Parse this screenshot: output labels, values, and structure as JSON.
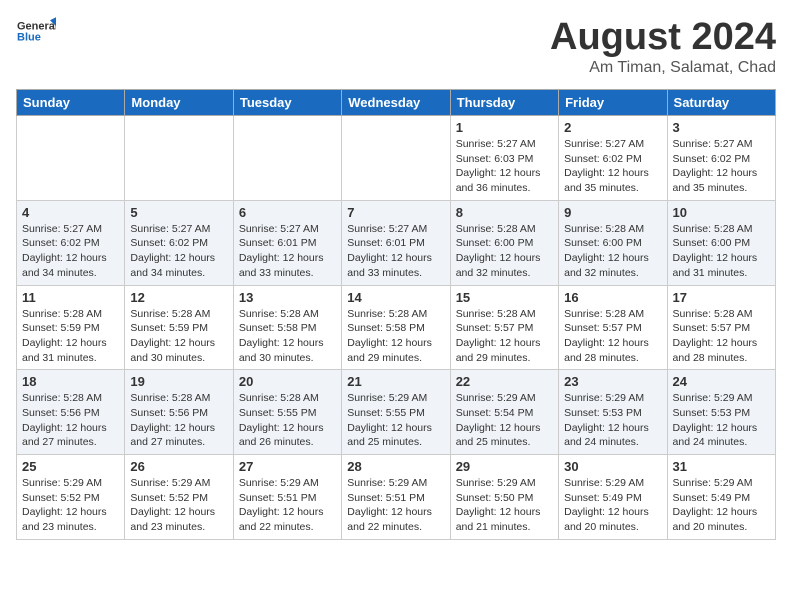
{
  "header": {
    "logo_general": "General",
    "logo_blue": "Blue",
    "month_title": "August 2024",
    "location": "Am Timan, Salamat, Chad"
  },
  "days_of_week": [
    "Sunday",
    "Monday",
    "Tuesday",
    "Wednesday",
    "Thursday",
    "Friday",
    "Saturday"
  ],
  "weeks": [
    {
      "alt": false,
      "days": [
        {
          "num": "",
          "info": ""
        },
        {
          "num": "",
          "info": ""
        },
        {
          "num": "",
          "info": ""
        },
        {
          "num": "",
          "info": ""
        },
        {
          "num": "1",
          "info": "Sunrise: 5:27 AM\nSunset: 6:03 PM\nDaylight: 12 hours\nand 36 minutes."
        },
        {
          "num": "2",
          "info": "Sunrise: 5:27 AM\nSunset: 6:02 PM\nDaylight: 12 hours\nand 35 minutes."
        },
        {
          "num": "3",
          "info": "Sunrise: 5:27 AM\nSunset: 6:02 PM\nDaylight: 12 hours\nand 35 minutes."
        }
      ]
    },
    {
      "alt": true,
      "days": [
        {
          "num": "4",
          "info": "Sunrise: 5:27 AM\nSunset: 6:02 PM\nDaylight: 12 hours\nand 34 minutes."
        },
        {
          "num": "5",
          "info": "Sunrise: 5:27 AM\nSunset: 6:02 PM\nDaylight: 12 hours\nand 34 minutes."
        },
        {
          "num": "6",
          "info": "Sunrise: 5:27 AM\nSunset: 6:01 PM\nDaylight: 12 hours\nand 33 minutes."
        },
        {
          "num": "7",
          "info": "Sunrise: 5:27 AM\nSunset: 6:01 PM\nDaylight: 12 hours\nand 33 minutes."
        },
        {
          "num": "8",
          "info": "Sunrise: 5:28 AM\nSunset: 6:00 PM\nDaylight: 12 hours\nand 32 minutes."
        },
        {
          "num": "9",
          "info": "Sunrise: 5:28 AM\nSunset: 6:00 PM\nDaylight: 12 hours\nand 32 minutes."
        },
        {
          "num": "10",
          "info": "Sunrise: 5:28 AM\nSunset: 6:00 PM\nDaylight: 12 hours\nand 31 minutes."
        }
      ]
    },
    {
      "alt": false,
      "days": [
        {
          "num": "11",
          "info": "Sunrise: 5:28 AM\nSunset: 5:59 PM\nDaylight: 12 hours\nand 31 minutes."
        },
        {
          "num": "12",
          "info": "Sunrise: 5:28 AM\nSunset: 5:59 PM\nDaylight: 12 hours\nand 30 minutes."
        },
        {
          "num": "13",
          "info": "Sunrise: 5:28 AM\nSunset: 5:58 PM\nDaylight: 12 hours\nand 30 minutes."
        },
        {
          "num": "14",
          "info": "Sunrise: 5:28 AM\nSunset: 5:58 PM\nDaylight: 12 hours\nand 29 minutes."
        },
        {
          "num": "15",
          "info": "Sunrise: 5:28 AM\nSunset: 5:57 PM\nDaylight: 12 hours\nand 29 minutes."
        },
        {
          "num": "16",
          "info": "Sunrise: 5:28 AM\nSunset: 5:57 PM\nDaylight: 12 hours\nand 28 minutes."
        },
        {
          "num": "17",
          "info": "Sunrise: 5:28 AM\nSunset: 5:57 PM\nDaylight: 12 hours\nand 28 minutes."
        }
      ]
    },
    {
      "alt": true,
      "days": [
        {
          "num": "18",
          "info": "Sunrise: 5:28 AM\nSunset: 5:56 PM\nDaylight: 12 hours\nand 27 minutes."
        },
        {
          "num": "19",
          "info": "Sunrise: 5:28 AM\nSunset: 5:56 PM\nDaylight: 12 hours\nand 27 minutes."
        },
        {
          "num": "20",
          "info": "Sunrise: 5:28 AM\nSunset: 5:55 PM\nDaylight: 12 hours\nand 26 minutes."
        },
        {
          "num": "21",
          "info": "Sunrise: 5:29 AM\nSunset: 5:55 PM\nDaylight: 12 hours\nand 25 minutes."
        },
        {
          "num": "22",
          "info": "Sunrise: 5:29 AM\nSunset: 5:54 PM\nDaylight: 12 hours\nand 25 minutes."
        },
        {
          "num": "23",
          "info": "Sunrise: 5:29 AM\nSunset: 5:53 PM\nDaylight: 12 hours\nand 24 minutes."
        },
        {
          "num": "24",
          "info": "Sunrise: 5:29 AM\nSunset: 5:53 PM\nDaylight: 12 hours\nand 24 minutes."
        }
      ]
    },
    {
      "alt": false,
      "days": [
        {
          "num": "25",
          "info": "Sunrise: 5:29 AM\nSunset: 5:52 PM\nDaylight: 12 hours\nand 23 minutes."
        },
        {
          "num": "26",
          "info": "Sunrise: 5:29 AM\nSunset: 5:52 PM\nDaylight: 12 hours\nand 23 minutes."
        },
        {
          "num": "27",
          "info": "Sunrise: 5:29 AM\nSunset: 5:51 PM\nDaylight: 12 hours\nand 22 minutes."
        },
        {
          "num": "28",
          "info": "Sunrise: 5:29 AM\nSunset: 5:51 PM\nDaylight: 12 hours\nand 22 minutes."
        },
        {
          "num": "29",
          "info": "Sunrise: 5:29 AM\nSunset: 5:50 PM\nDaylight: 12 hours\nand 21 minutes."
        },
        {
          "num": "30",
          "info": "Sunrise: 5:29 AM\nSunset: 5:49 PM\nDaylight: 12 hours\nand 20 minutes."
        },
        {
          "num": "31",
          "info": "Sunrise: 5:29 AM\nSunset: 5:49 PM\nDaylight: 12 hours\nand 20 minutes."
        }
      ]
    }
  ]
}
